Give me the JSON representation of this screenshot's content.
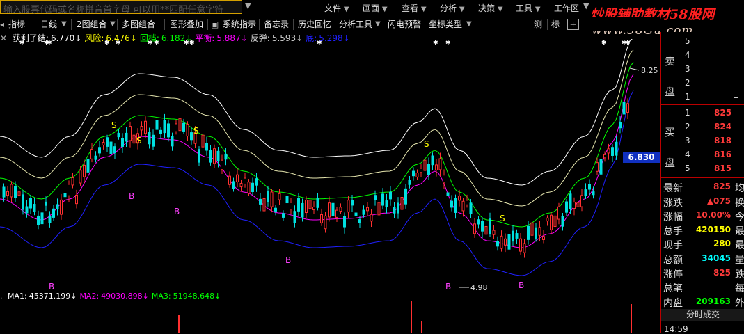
{
  "search": {
    "text": "输入股票代码或名称拼音首字母 可以用**匹配任意字符"
  },
  "menubar": {
    "items": [
      "文件",
      "画面",
      "查看",
      "分析",
      "决策",
      "工具",
      "工作区"
    ]
  },
  "toolbar": {
    "items": [
      "指标",
      "日线",
      "2图组合",
      "多图组合",
      "图形叠加",
      "系统指示",
      "备忘录",
      "历史回忆",
      "分析工具",
      "闪电预警",
      "坐标类型",
      "测",
      "标"
    ]
  },
  "indicator": {
    "items": [
      {
        "label": "获利了结:",
        "value": "6.770↓",
        "color": "#ffffff"
      },
      {
        "label": "风险:",
        "value": "6.476↓",
        "color": "#ffff00"
      },
      {
        "label": "回档:",
        "value": "6.182↓",
        "color": "#00ff00"
      },
      {
        "label": "平衡:",
        "value": "5.887↓",
        "color": "#ff00ff"
      },
      {
        "label": "反弹:",
        "value": "5.593↓",
        "color": "#cccccc"
      },
      {
        "label": "底:",
        "value": "5.298↓",
        "color": "#2020ff"
      }
    ]
  },
  "chart_annotations": {
    "high_label": "8.25",
    "low_label": "4.98",
    "current_price": "6.830",
    "s_marks": [
      "S",
      "S",
      "S",
      "S",
      "S"
    ],
    "b_marks": [
      "B",
      "B",
      "B",
      "B",
      "B",
      "B"
    ]
  },
  "volume": {
    "items": [
      {
        "label": "MA1:",
        "value": "45371.199↓",
        "color": "#ffffff"
      },
      {
        "label": "MA2:",
        "value": "49030.898↓",
        "color": "#ff00ff"
      },
      {
        "label": "MA3:",
        "value": "51948.648↓",
        "color": "#00ff00"
      }
    ]
  },
  "watermark": {
    "title": "炒股辅助教材58股网",
    "url": "www.58Gu.com"
  },
  "order_book": {
    "sell_label": "卖盘",
    "buy_label": "买盘",
    "sell": [
      {
        "level": "5",
        "price": "",
        "vol": ""
      },
      {
        "level": "4",
        "price": "",
        "vol": ""
      },
      {
        "level": "3",
        "price": "",
        "vol": ""
      },
      {
        "level": "2",
        "price": "",
        "vol": ""
      },
      {
        "level": "1",
        "price": "",
        "vol": ""
      }
    ],
    "buy": [
      {
        "level": "1",
        "price": "825"
      },
      {
        "level": "2",
        "price": "824"
      },
      {
        "level": "3",
        "price": "818"
      },
      {
        "level": "4",
        "price": "816"
      },
      {
        "level": "5",
        "price": "815"
      }
    ]
  },
  "stats": [
    {
      "label": "最新",
      "value": "825",
      "color": "#ff3a3a",
      "extra": "均"
    },
    {
      "label": "涨跌",
      "value": "▲075",
      "color": "#ff3a3a",
      "extra": "换"
    },
    {
      "label": "涨幅",
      "value": "10.00%",
      "color": "#ff3a3a",
      "extra": "今"
    },
    {
      "label": "总手",
      "value": "420150",
      "color": "#ffff00",
      "extra": "最"
    },
    {
      "label": "现手",
      "value": "280",
      "color": "#ffff00",
      "extra": "最"
    },
    {
      "label": "总额",
      "value": "34045",
      "color": "#00ffff",
      "extra": "量"
    },
    {
      "label": "涨停",
      "value": "825",
      "color": "#ff3a3a",
      "extra": "跌"
    },
    {
      "label": "总笔",
      "value": "",
      "color": "#ffffff",
      "extra": "每"
    },
    {
      "label": "内盘",
      "value": "209163",
      "color": "#00ff00",
      "extra": "外"
    }
  ],
  "tick_header": "分时成交",
  "tick_time": "14:59"
}
